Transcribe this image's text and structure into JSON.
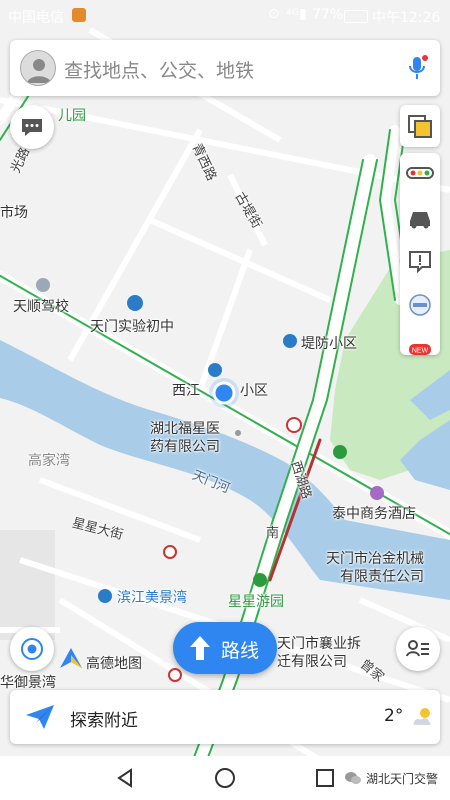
{
  "status_bar": {
    "carrier": "中国电信",
    "battery": "77%",
    "time": "中午12:26"
  },
  "search": {
    "placeholder": "查找地点、公交、地铁"
  },
  "map_labels": {
    "park_top": "儿园",
    "road_left": "光路",
    "market": "市场",
    "road_qingxi": "青西路",
    "road_gudi": "古堤街",
    "driving_school": "天顺驾校",
    "middle_school": "天门实验初中",
    "difang": "堤防小区",
    "xijiang": "西江",
    "xijiang_suffix": "小区",
    "hospital_1": "湖北福星医",
    "hospital_2": "药有限公司",
    "gaojiawan": "高家湾",
    "river": "天门河",
    "xihu_road": "西湖路",
    "xihu_south": "南",
    "hotel": "泰中商务酒店",
    "xingxing_street": "星星大街",
    "metal_1": "天门市冶金机械",
    "metal_2": "有限责任公司",
    "binjiang": "滨江美景湾",
    "xingxing_park": "星星游园",
    "demolition_1": "天门市襄业拆",
    "demolition_2": "迁有限公司",
    "gaode": "高德地图",
    "huayu": "华御景湾",
    "road_right_bottom": "曾家"
  },
  "route_button": {
    "label": "路线"
  },
  "explore": {
    "label": "探索附近",
    "temperature": "2°"
  },
  "watermark": "湖北天门交警",
  "colors": {
    "accent": "#2f86f0",
    "water": "#a9cde8",
    "park": "#c9e9c0",
    "road_green": "#2fb24d",
    "road_red": "#b23535"
  }
}
